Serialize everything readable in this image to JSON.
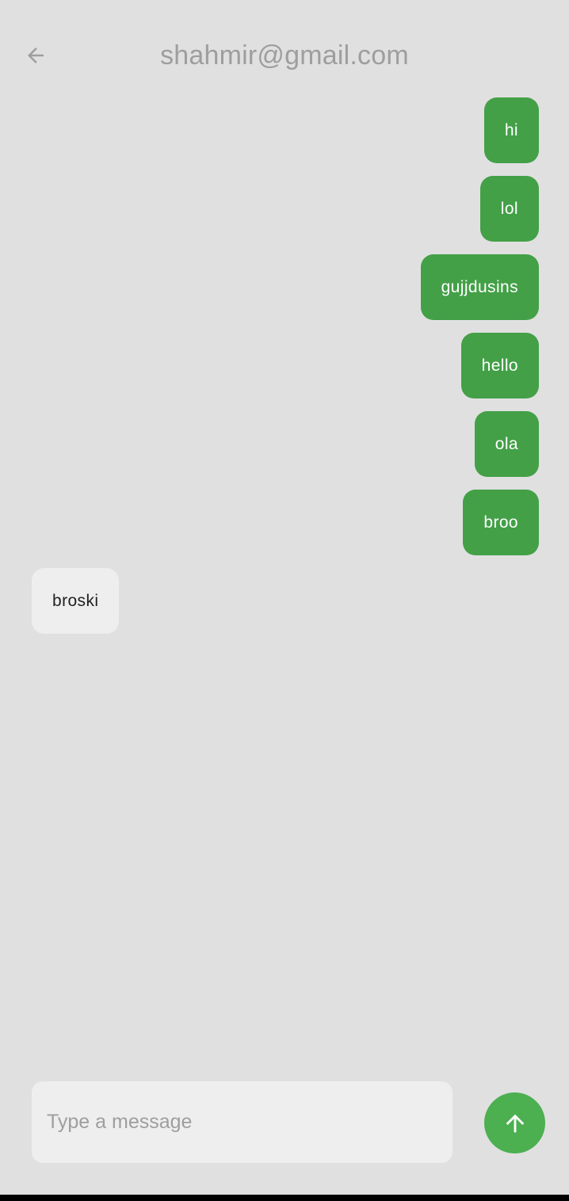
{
  "header": {
    "title": "shahmir@gmail.com",
    "back_icon": "arrow-back-icon"
  },
  "messages": [
    {
      "text": "hi",
      "direction": "sent"
    },
    {
      "text": "lol",
      "direction": "sent"
    },
    {
      "text": "gujjdusins",
      "direction": "sent"
    },
    {
      "text": "hello",
      "direction": "sent"
    },
    {
      "text": "ola",
      "direction": "sent"
    },
    {
      "text": "broo",
      "direction": "sent"
    },
    {
      "text": "broski",
      "direction": "received"
    }
  ],
  "composer": {
    "placeholder": "Type a message",
    "value": "",
    "send_icon": "arrow-upward-icon"
  },
  "colors": {
    "background": "#e0e0e0",
    "sent_bubble": "#43a047",
    "received_bubble": "#eeeeee",
    "send_button": "#4caf50",
    "title_text": "#9e9e9e"
  }
}
